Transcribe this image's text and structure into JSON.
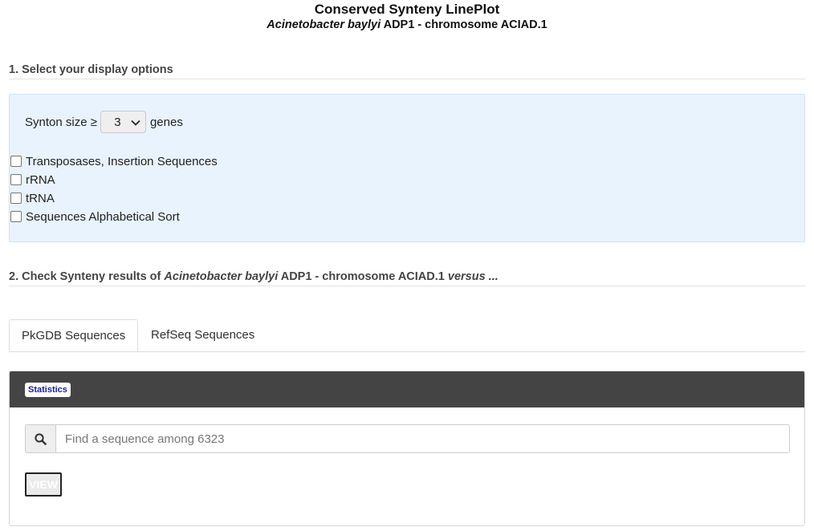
{
  "header": {
    "title": "Conserved Synteny LinePlot",
    "subtitle_species": "Acinetobacter baylyi",
    "subtitle_rest": " ADP1 - chromosome ACIAD.1"
  },
  "section1": {
    "heading": "1. Select your display options",
    "synton_label": "Synton size ≥",
    "synton_value": "3",
    "synton_unit": "genes",
    "checkboxes": [
      {
        "label": "Transposases, Insertion Sequences",
        "checked": false
      },
      {
        "label": "rRNA",
        "checked": false
      },
      {
        "label": "tRNA",
        "checked": false
      },
      {
        "label": "Sequences Alphabetical Sort",
        "checked": false
      }
    ]
  },
  "section2": {
    "heading_prefix": "2. Check Synteny results of ",
    "heading_species": "Acinetobacter baylyi",
    "heading_middle": " ADP1 - chromosome ACIAD.1 ",
    "heading_suffix": "versus ..."
  },
  "tabs": [
    {
      "label": "PkGDB Sequences",
      "active": true
    },
    {
      "label": "RefSeq Sequences",
      "active": false
    }
  ],
  "results": {
    "statistics_label": "Statistics",
    "search_placeholder": "Find a sequence among 6323",
    "view_button": "VIEW"
  },
  "icons": {
    "search": "search-icon",
    "select_arrow": "chevron-down-icon"
  }
}
